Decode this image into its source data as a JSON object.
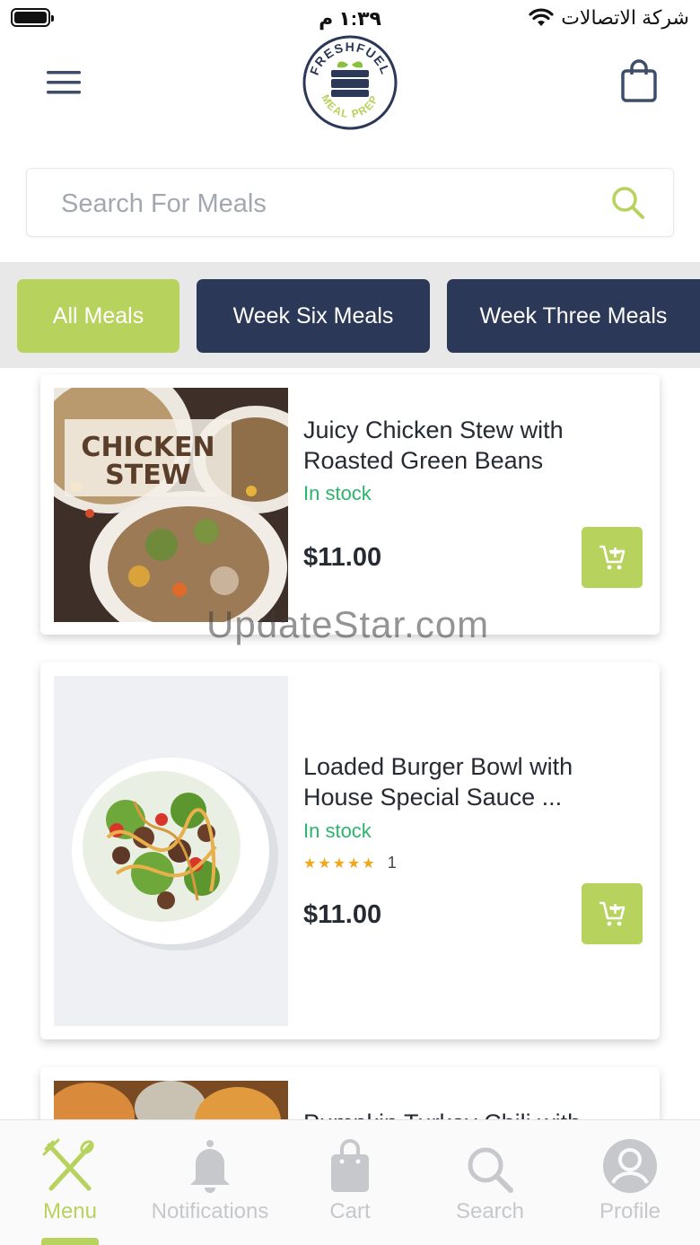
{
  "status_bar": {
    "time": "١:٣٩ م",
    "carrier": "شركة الاتصالات"
  },
  "search": {
    "placeholder": "Search For Meals"
  },
  "tabs": [
    {
      "label": "All Meals",
      "active": true
    },
    {
      "label": "Week Six Meals",
      "active": false
    },
    {
      "label": "Week Three Meals",
      "active": false
    }
  ],
  "products": [
    {
      "title": "Juicy Chicken Stew with Roasted Green Beans",
      "stock": "In stock",
      "price": "$11.00",
      "image_text": "CHICKEN STEW"
    },
    {
      "title": "Loaded Burger Bowl with House Special Sauce ...",
      "stock": "In stock",
      "rating": 5,
      "rating_count": "1",
      "price": "$11.00"
    },
    {
      "title": "Pumpkin Turkey Chili with"
    }
  ],
  "watermark": "UpdateStar.com",
  "bottom_nav": [
    {
      "label": "Menu",
      "icon": "fork-knife-icon",
      "active": true
    },
    {
      "label": "Notifications",
      "icon": "bell-icon",
      "active": false
    },
    {
      "label": "Cart",
      "icon": "shopping-bag-icon",
      "active": false
    },
    {
      "label": "Search",
      "icon": "search-icon",
      "active": false
    },
    {
      "label": "Profile",
      "icon": "user-icon",
      "active": false
    }
  ],
  "colors": {
    "accent": "#b7d25d",
    "navy": "#2c3857",
    "in_stock": "#2bb56b",
    "star": "#f0a81a"
  }
}
